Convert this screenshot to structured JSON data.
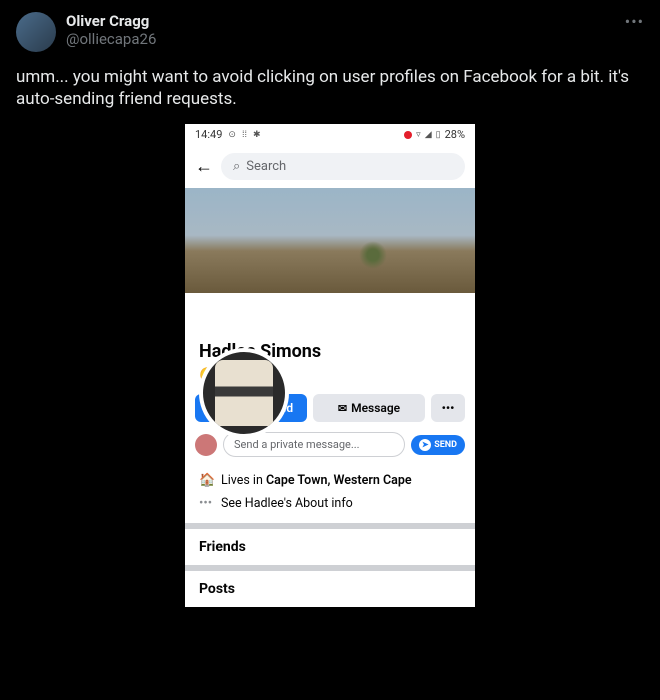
{
  "tweet": {
    "author_name": "Oliver Cragg",
    "author_handle": "@olliecapa26",
    "text": "umm... you might want to avoid clicking on user profiles on Facebook for a bit. it's auto-sending friend requests.",
    "more": "•••"
  },
  "phone": {
    "status": {
      "time": "14:49",
      "battery": "28%"
    },
    "search": {
      "placeholder": "Search"
    },
    "profile": {
      "name": "Hadlee Simons",
      "emoji": "😛"
    },
    "buttons": {
      "requested": "Requested",
      "message": "Message",
      "more": "•••"
    },
    "pm": {
      "placeholder": "Send a private message...",
      "send": "SEND"
    },
    "info": {
      "lives_prefix": "Lives in ",
      "lives_location": "Cape Town, Western Cape",
      "about": "See Hadlee's About info"
    },
    "sections": {
      "friends": "Friends",
      "posts": "Posts"
    }
  }
}
